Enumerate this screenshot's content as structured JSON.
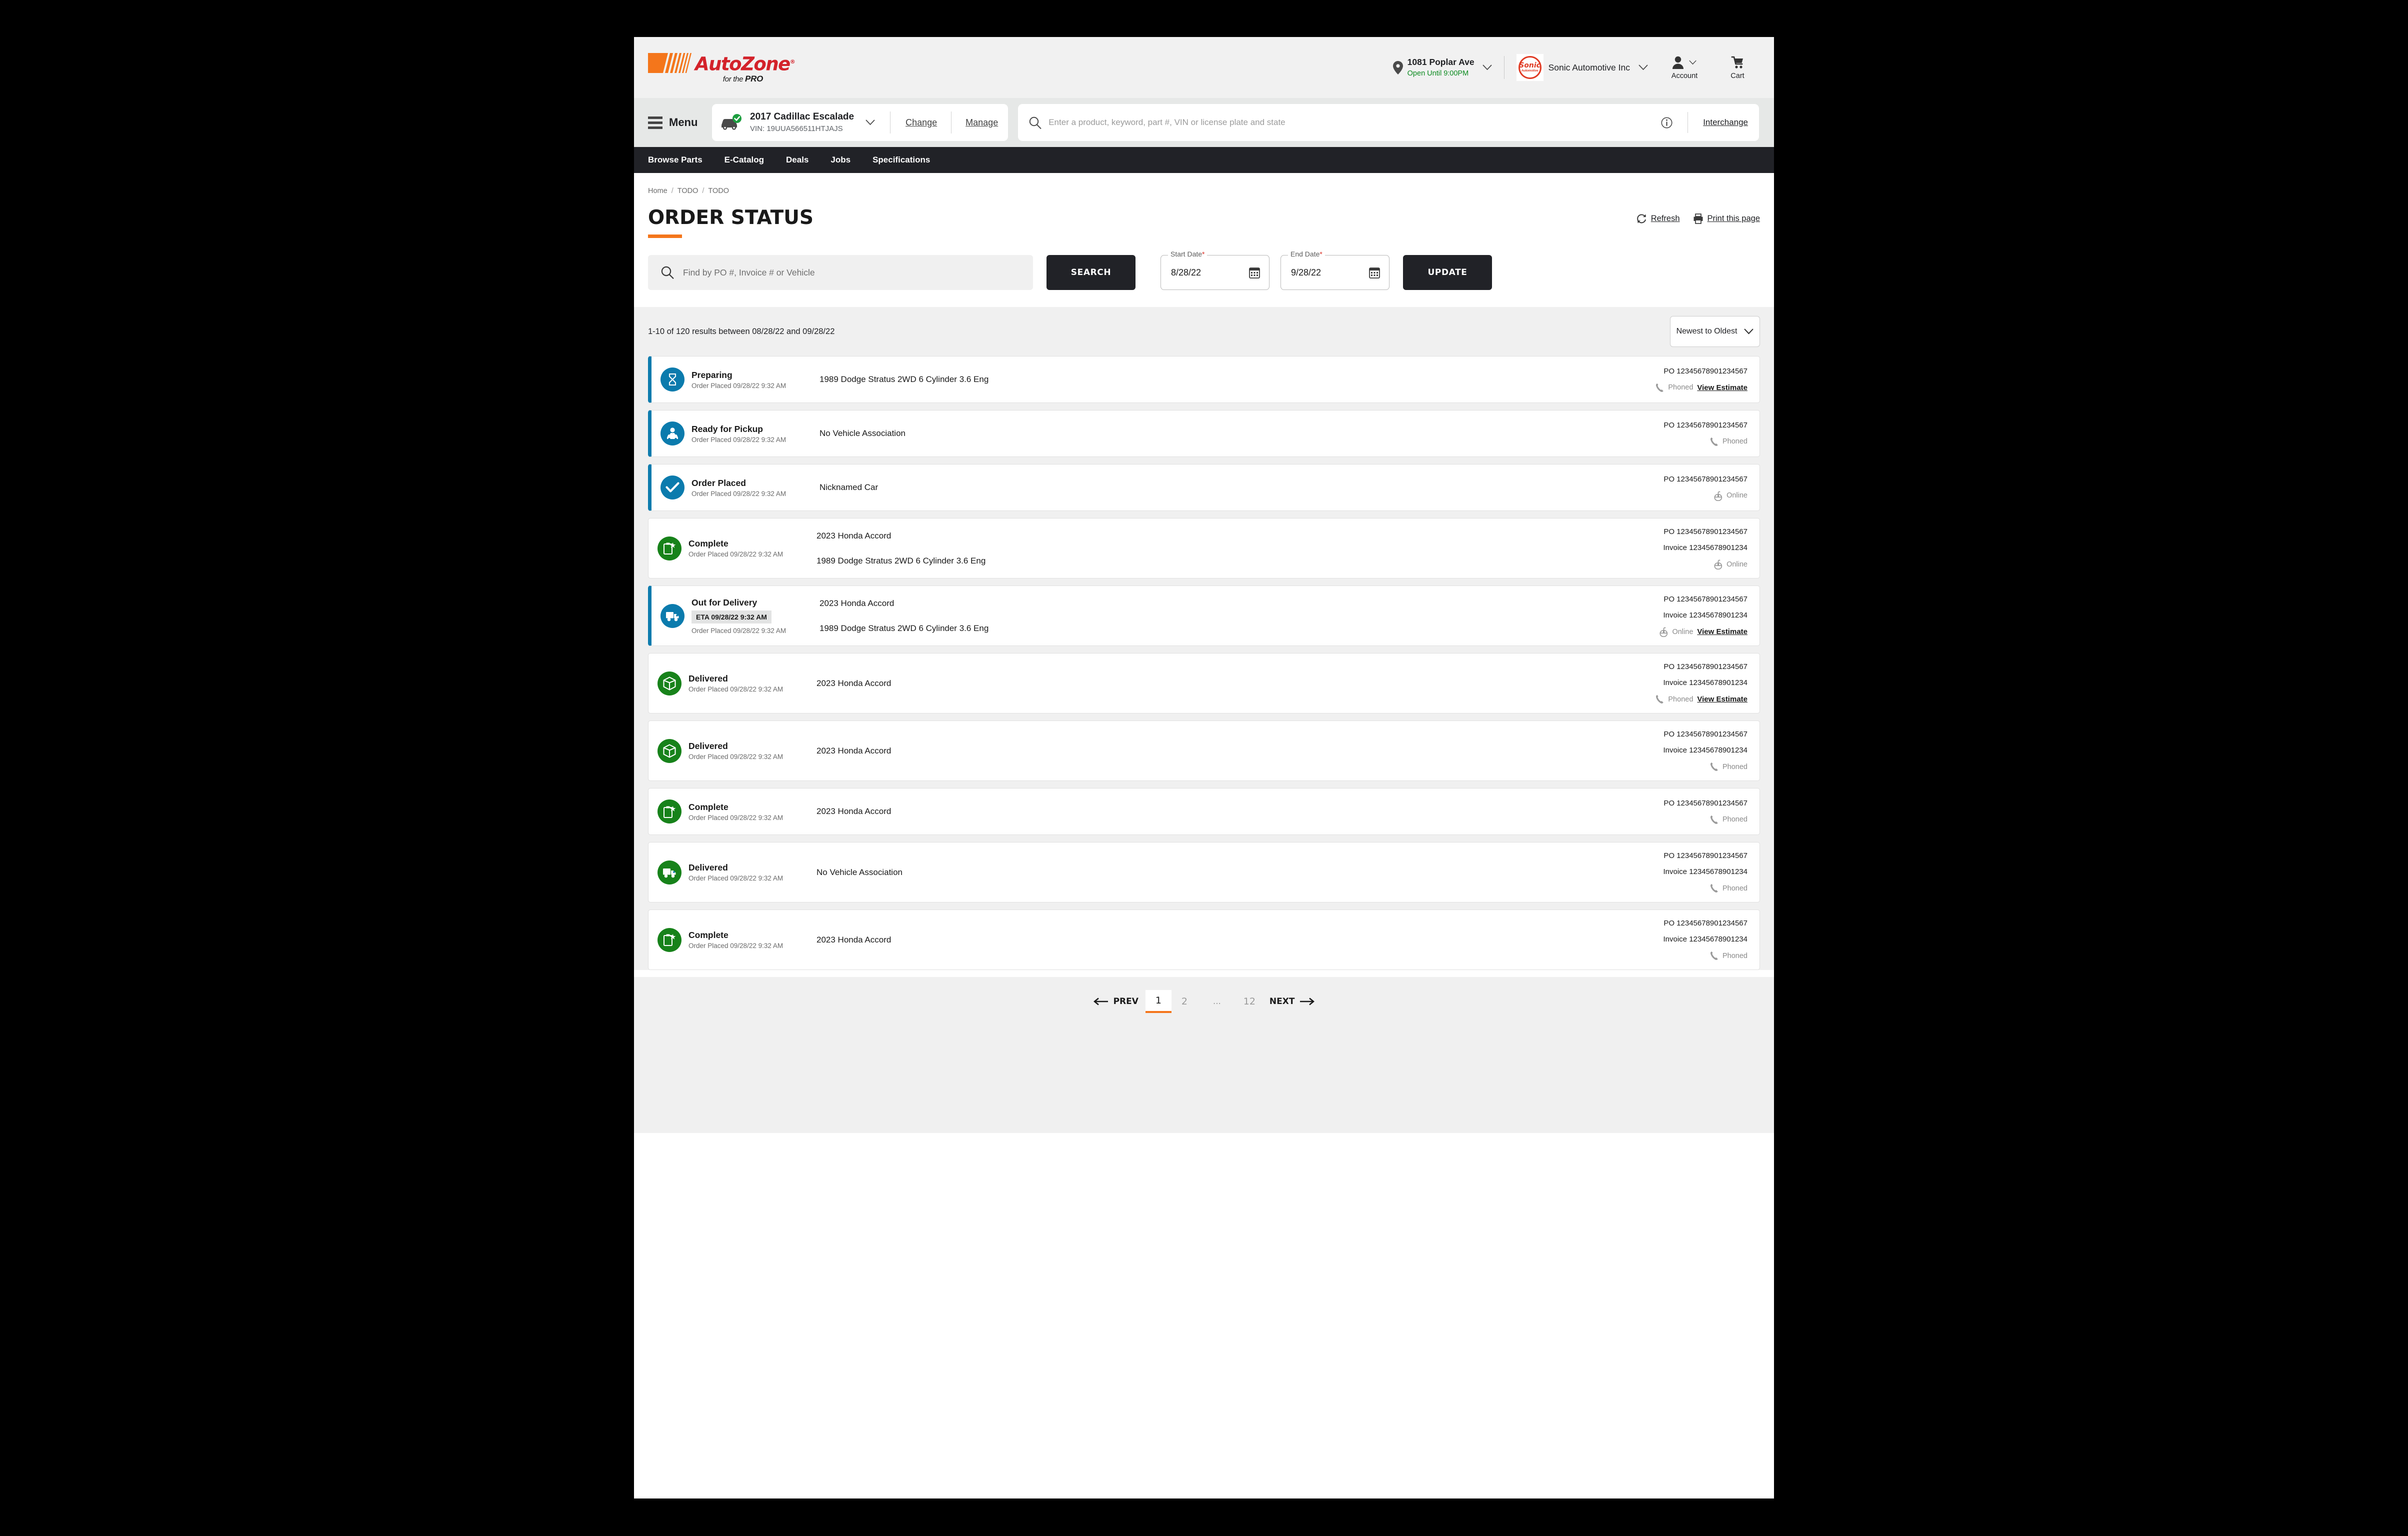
{
  "header": {
    "logo": {
      "word": "AutoZone",
      "tagline_pre": "for the ",
      "tagline_bold": "PRO"
    },
    "store": {
      "name": "1081 Poplar Ave",
      "hours": "Open Until 9:00PM"
    },
    "company": {
      "name": "Sonic Automotive Inc",
      "mark_top": "Sonic",
      "mark_bottom": "Automotive"
    },
    "account_label": "Account",
    "cart_label": "Cart"
  },
  "vehicle_bar": {
    "menu_label": "Menu",
    "vehicle_title": "2017 Cadillac Escalade",
    "vehicle_vin": "VIN: 19UUA566511HTJAJS",
    "change_label": "Change",
    "manage_label": "Manage",
    "search_placeholder": "Enter a product, keyword, part #, VIN or license plate and state",
    "interchange_label": "Interchange"
  },
  "nav": {
    "items": [
      "Browse Parts",
      "E-Catalog",
      "Deals",
      "Jobs",
      "Specifications"
    ]
  },
  "breadcrumbs": [
    "Home",
    "TODO",
    "TODO"
  ],
  "page": {
    "title": "ORDER STATUS",
    "refresh_label": "Refresh",
    "print_label": "Print this page"
  },
  "controls": {
    "find_placeholder": "Find by PO #, Invoice # or Vehicle",
    "search_button": "SEARCH",
    "start_date_label": "Start Date",
    "start_date_value": "8/28/22",
    "end_date_label": "End Date",
    "end_date_value": "9/28/22",
    "update_button": "UPDATE",
    "required_mark": "*"
  },
  "results": {
    "count_text": "1-10 of 120 results between 08/28/22 and 09/28/22",
    "sort_value": "Newest to Oldest"
  },
  "orders": [
    {
      "status": "Preparing",
      "icon": "hourglass-icon",
      "icon_color": "blue",
      "accent": true,
      "eta": null,
      "placed": "Order Placed 09/28/22 9:32 AM",
      "vehicles": [
        "1989 Dodge Stratus 2WD 6 Cylinder 3.6 Eng"
      ],
      "po": "PO 12345678901234567",
      "invoice": null,
      "channel": "Phoned",
      "channel_icon": "phone-icon",
      "estimate": "View Estimate"
    },
    {
      "status": "Ready for Pickup",
      "icon": "pickup-car-icon",
      "icon_color": "blue",
      "accent": true,
      "eta": null,
      "placed": "Order Placed 09/28/22 9:32 AM",
      "vehicles": [
        "No Vehicle Association"
      ],
      "po": "PO 12345678901234567",
      "invoice": null,
      "channel": "Phoned",
      "channel_icon": "phone-icon",
      "estimate": null
    },
    {
      "status": "Order Placed",
      "icon": "check-circle-icon",
      "icon_color": "blue",
      "accent": true,
      "eta": null,
      "placed": "Order Placed 09/28/22 9:32 AM",
      "vehicles": [
        "Nicknamed Car"
      ],
      "po": "PO 12345678901234567",
      "invoice": null,
      "channel": "Online",
      "channel_icon": "mouse-icon",
      "estimate": null
    },
    {
      "status": "Complete",
      "icon": "clipboard-star-icon",
      "icon_color": "green",
      "accent": false,
      "eta": null,
      "placed": "Order Placed 09/28/22 9:32 AM",
      "vehicles": [
        "2023 Honda Accord",
        "1989 Dodge Stratus 2WD 6 Cylinder 3.6 Eng"
      ],
      "po": "PO 12345678901234567",
      "invoice": "Invoice 12345678901234",
      "channel": "Online",
      "channel_icon": "mouse-icon",
      "estimate": null
    },
    {
      "status": "Out for Delivery",
      "icon": "delivery-truck-icon",
      "icon_color": "blue",
      "accent": true,
      "eta": "ETA 09/28/22 9:32 AM",
      "placed": "Order Placed 09/28/22 9:32 AM",
      "vehicles": [
        "2023 Honda Accord",
        "1989 Dodge Stratus 2WD 6 Cylinder 3.6 Eng"
      ],
      "po": "PO 12345678901234567",
      "invoice": "Invoice 12345678901234",
      "channel": "Online",
      "channel_icon": "mouse-icon",
      "estimate": "View Estimate"
    },
    {
      "status": "Delivered",
      "icon": "package-icon",
      "icon_color": "green",
      "accent": false,
      "eta": null,
      "placed": "Order Placed 09/28/22 9:32 AM",
      "vehicles": [
        "2023 Honda Accord"
      ],
      "po": "PO 12345678901234567",
      "invoice": "Invoice 12345678901234",
      "channel": "Phoned",
      "channel_icon": "phone-icon",
      "estimate": "View Estimate"
    },
    {
      "status": "Delivered",
      "icon": "package-icon",
      "icon_color": "green",
      "accent": false,
      "eta": null,
      "placed": "Order Placed 09/28/22 9:32 AM",
      "vehicles": [
        "2023 Honda Accord"
      ],
      "po": "PO 12345678901234567",
      "invoice": "Invoice 12345678901234",
      "channel": "Phoned",
      "channel_icon": "phone-icon",
      "estimate": null
    },
    {
      "status": "Complete",
      "icon": "clipboard-star-icon",
      "icon_color": "green",
      "accent": false,
      "eta": null,
      "placed": "Order Placed 09/28/22 9:32 AM",
      "vehicles": [
        "2023 Honda Accord"
      ],
      "po": "PO 12345678901234567",
      "invoice": null,
      "channel": "Phoned",
      "channel_icon": "phone-icon",
      "estimate": null
    },
    {
      "status": "Delivered",
      "icon": "delivery-truck-icon",
      "icon_color": "green",
      "accent": false,
      "eta": null,
      "placed": "Order Placed 09/28/22 9:32 AM",
      "vehicles": [
        "No Vehicle Association"
      ],
      "po": "PO 12345678901234567",
      "invoice": "Invoice 12345678901234",
      "channel": "Phoned",
      "channel_icon": "phone-icon",
      "estimate": null
    },
    {
      "status": "Complete",
      "icon": "clipboard-star-icon",
      "icon_color": "green",
      "accent": false,
      "eta": null,
      "placed": "Order Placed 09/28/22 9:32 AM",
      "vehicles": [
        "2023 Honda Accord"
      ],
      "po": "PO 12345678901234567",
      "invoice": "Invoice 12345678901234",
      "channel": "Phoned",
      "channel_icon": "phone-icon",
      "estimate": null
    }
  ],
  "pagination": {
    "prev_label": "PREV",
    "next_label": "NEXT",
    "pages": [
      "1",
      "2",
      "...",
      "12"
    ],
    "current": "1"
  },
  "colors": {
    "brand_orange": "#f4761b",
    "brand_red": "#d3222a",
    "accent_blue": "#0b7bad",
    "accent_green": "#17821a",
    "nav_dark": "#212227",
    "page_bg": "#f0f0f0"
  }
}
